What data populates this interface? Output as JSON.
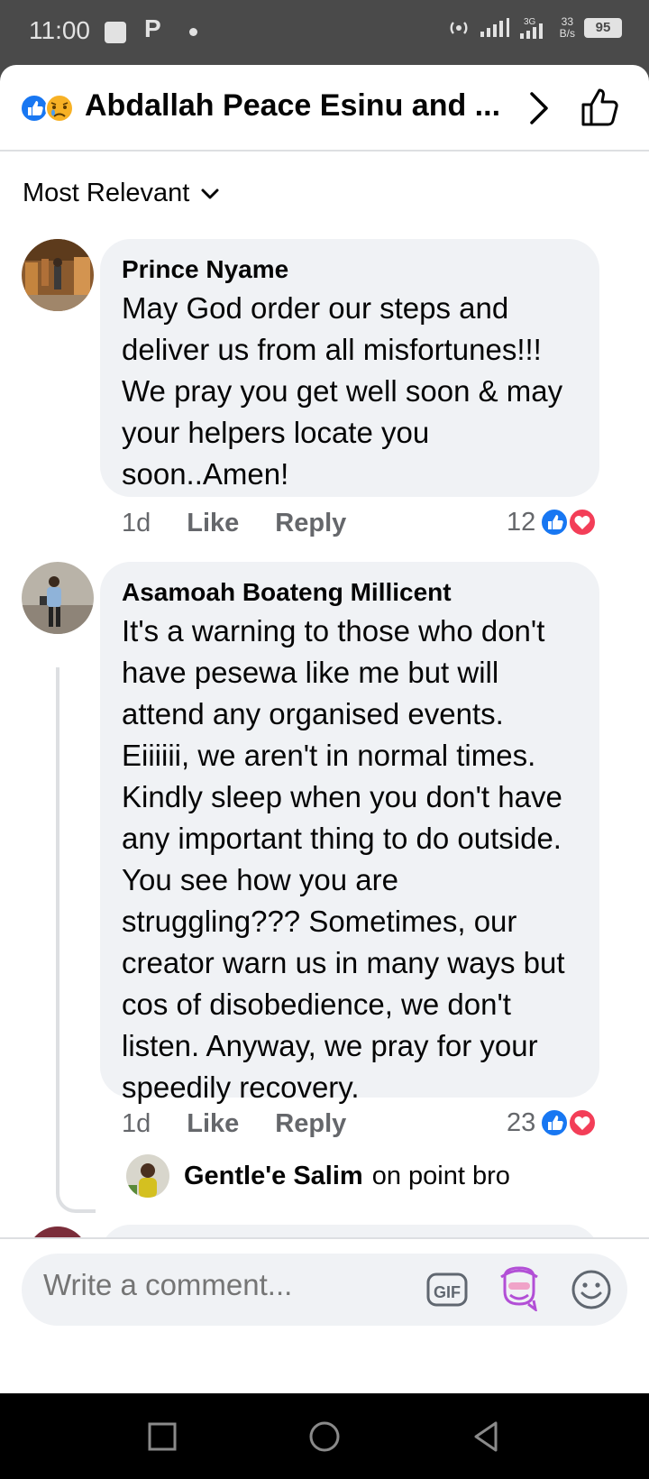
{
  "status_bar": {
    "time": "11:00",
    "p_label": "P",
    "network": "3G",
    "speed_value": "33",
    "speed_unit": "B/s",
    "battery": "95"
  },
  "header": {
    "title": "Abdallah Peace Esinu and ..."
  },
  "sort": {
    "label": "Most Relevant"
  },
  "comments": [
    {
      "author": "Prince Nyame",
      "text": "May God order our steps and deliver us from all misfortunes!!! We pray  you get well soon & may your helpers locate you soon..Amen!",
      "age": "1d",
      "like_label": "Like",
      "reply_label": "Reply",
      "reaction_count": "12"
    },
    {
      "author": "Asamoah Boateng Millicent",
      "text": "It's a warning to those who don't have pesewa like me but will attend any organised events. Eiiiiii, we  aren't in normal times. Kindly sleep when you don't have any important thing to do outside. You see how you are struggling??? Sometimes, our creator warn us in many ways but cos of disobedience, we don't listen. Anyway, we pray for your speedily recovery.",
      "age": "1d",
      "like_label": "Like",
      "reply_label": "Reply",
      "reaction_count": "23"
    }
  ],
  "reply": {
    "author": "Gentle'e Salim",
    "text": "on point bro"
  },
  "composer": {
    "placeholder": "Write a comment...",
    "gif_label": "GIF"
  },
  "colors": {
    "like_blue": "#1877f2",
    "love_red": "#f33e58",
    "bubble_gray": "#f0f2f5",
    "text_secondary": "#65676b"
  }
}
